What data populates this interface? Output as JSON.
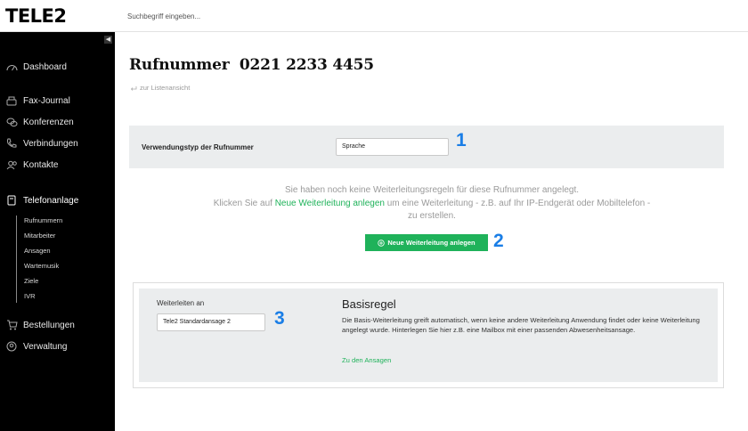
{
  "brand": {
    "logo": "TELE2"
  },
  "search": {
    "placeholder": "Suchbegriff eingeben..."
  },
  "sidebar": {
    "collapse_icon": "triangle-left-icon",
    "items": [
      {
        "label": "Dashboard",
        "icon": "gauge-icon"
      },
      {
        "label": "Fax-Journal",
        "icon": "fax-icon"
      },
      {
        "label": "Konferenzen",
        "icon": "chat-bubbles-icon"
      },
      {
        "label": "Verbindungen",
        "icon": "phone-icon"
      },
      {
        "label": "Kontakte",
        "icon": "contacts-icon"
      },
      {
        "label": "Telefonanlage",
        "icon": "pbx-icon",
        "active": true
      },
      {
        "label": "Bestellungen",
        "icon": "cart-icon"
      },
      {
        "label": "Verwaltung",
        "icon": "admin-icon"
      }
    ],
    "subitems": [
      "Rufnummern",
      "Mitarbeiter",
      "Ansagen",
      "Wartemusik",
      "Ziele",
      "IVR"
    ]
  },
  "page": {
    "title": "Rufnummer  0221 2233 4455",
    "back_link": "zur Listenansicht"
  },
  "usage": {
    "label": "Verwendungstyp der Rufnummer",
    "value": "Sprache",
    "marker": "1"
  },
  "info": {
    "line1": "Sie haben noch keine Weiterleitungsregeln für diese Rufnummer angelegt.",
    "line2_pre": "Klicken Sie auf ",
    "line2_link": "Neue Weiterleitung anlegen",
    "line2_post": " um eine Weiterleitung - z.B. auf Ihr IP-Endgerät oder Mobiltelefon -",
    "line3": "zu erstellen."
  },
  "cta": {
    "label": "Neue Weiterleitung anlegen",
    "marker": "2"
  },
  "rule": {
    "forward_label": "Weiterleiten an",
    "forward_value": "Tele2 Standardansage 2",
    "marker": "3",
    "title": "Basisregel",
    "description": "Die Basis-Weiterleitung greift automatisch, wenn keine andere Weiterleitung Anwendung findet oder keine Weiterleitung angelegt wurde. Hinterlegen Sie hier z.B. eine Mailbox mit einer passenden Abwesenheitsansage.",
    "link": "Zu den Ansagen"
  },
  "colors": {
    "accent_green": "#1fb25a",
    "marker_blue": "#1a7ee6",
    "sidebar_bg": "#000000",
    "panel_bg": "#ebedee"
  }
}
